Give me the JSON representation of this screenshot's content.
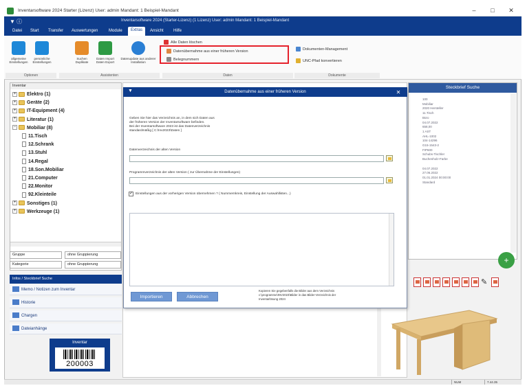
{
  "window": {
    "title": "Inventarsoftware 2024 Starter (Lizenz)   User: admin   Mandant: 1 Beispiel-Mandant",
    "info_bar_text": "Inventarsoftware 2024 (Starter-Lizenz) (1 Lizenz)   User: admin   Mandant: 1 Beispiel-Mandant",
    "minimize": "–",
    "maximize": "□",
    "close": "✕"
  },
  "menu": [
    "Datei",
    "Start",
    "Transfer",
    "Auswertungen",
    "Module",
    "Extras",
    "Ansicht",
    "Hilfe"
  ],
  "menu_active": "Extras",
  "ribbon": {
    "groups": [
      {
        "label": "Optionen",
        "buttons": [
          "allgemeine Einstellungen",
          "persönliche Einstellungen"
        ]
      },
      {
        "label": "Assistenten",
        "buttons": [
          "Suchen Duplikate",
          "Daten Import Daten Export",
          "Datenupdate aus anderer Installation"
        ]
      },
      {
        "label": "Daten",
        "items": [
          "Alle Daten löschen",
          "Datenübernahme aus einer früheren Version",
          "Belegnummern"
        ]
      },
      {
        "label": "Dokumente",
        "items": [
          "Dokumenten-Management",
          "UNC-Pfad konvertieren"
        ]
      }
    ]
  },
  "tree": {
    "header": "Inventar",
    "items": [
      {
        "label": "Elektro  (1)",
        "level": 0,
        "expander": "+"
      },
      {
        "label": "Geräte  (2)",
        "level": 0,
        "expander": "+"
      },
      {
        "label": "IT-Equipment  (4)",
        "level": 0,
        "expander": "+"
      },
      {
        "label": "Literatur  (1)",
        "level": 0,
        "expander": "+"
      },
      {
        "label": "Mobiliar  (8)",
        "level": 0,
        "expander": "−"
      },
      {
        "label": "11.Tisch",
        "level": 1
      },
      {
        "label": "12.Schrank",
        "level": 1
      },
      {
        "label": "13.Stuhl",
        "level": 1
      },
      {
        "label": "14.Regal",
        "level": 1
      },
      {
        "label": "18.Son.Mobiliar",
        "level": 1
      },
      {
        "label": "21.Computer",
        "level": 1
      },
      {
        "label": "22.Monitor",
        "level": 1
      },
      {
        "label": "92.Kleinteile",
        "level": 1
      },
      {
        "label": "Sonstiges  (1)",
        "level": 0,
        "expander": "+"
      },
      {
        "label": "Werkzeuge  (1)",
        "level": 0,
        "expander": "+"
      }
    ]
  },
  "filters": [
    {
      "field": "Gruppe",
      "value": "ohne Gruppierung"
    },
    {
      "field": "Kategorie",
      "value": "ohne Gruppierung"
    }
  ],
  "nav": {
    "header": "Infos / Steckbrief Suche",
    "items": [
      "Memo / Notizen zum Inventar",
      "Historie",
      "Chargen",
      "Dateianhänge"
    ]
  },
  "barcode": {
    "title": "Inventar",
    "number": "200003"
  },
  "right_panel": {
    "header": "Steckbrief Suche",
    "lines": [
      "100",
      "Mobiliar",
      "2020 Hersteller",
      "11.Tisch",
      "Büro",
      "04.07.2022",
      "658,00",
      "1 AST",
      "AHL-1002",
      "104-14296",
      "G15-1543-2",
      "FIP600",
      "Schubs-Tischler",
      "Buchenholz-Farbe",
      "",
      "04.07.2022",
      "27.06.2022",
      "01.01.2024 00:00:00",
      "Standard"
    ]
  },
  "dialog": {
    "title": "Datenübernahme aus einer früheren Version",
    "intro_lines": [
      "Geben Sie hier das Verzeichnis an, in dem sich Daten aus",
      "der früheren Version der Inventarsoftware befinden.",
      "Bei der Inventarsoftware 2023 ist das Datenverzeichnis",
      "standardmäßig [ C:\\Inv2023\\Daten ]"
    ],
    "data_dir_label": "Datenverzeichnis der alten Version",
    "data_dir_value": "",
    "prog_dir_label": "Programmverzeichnis der alten Version ( zur Übernahme der Einstellungen)",
    "prog_dir_value": "",
    "checkbox_checked": true,
    "checkbox_label": "Einstellungen aus der vorherigen Version übernehmen ? ( Nummernkreis, Einstellung der Auswahllisten...)",
    "import_button": "Importieren",
    "cancel_button": "Abbrechen",
    "note": "Kopieren Sie gegebenfalls die Bilder aus dem Verzeichnis c:\\programme\\INV2023\\Bilder in das Bilder-Verzeichnis der Inventarlösung 2024"
  },
  "status": [
    "NUM",
    "7.44.35"
  ],
  "colors": {
    "accent": "#0e3c8c",
    "highlight": "#e5202a",
    "button": "#6f98d4"
  }
}
